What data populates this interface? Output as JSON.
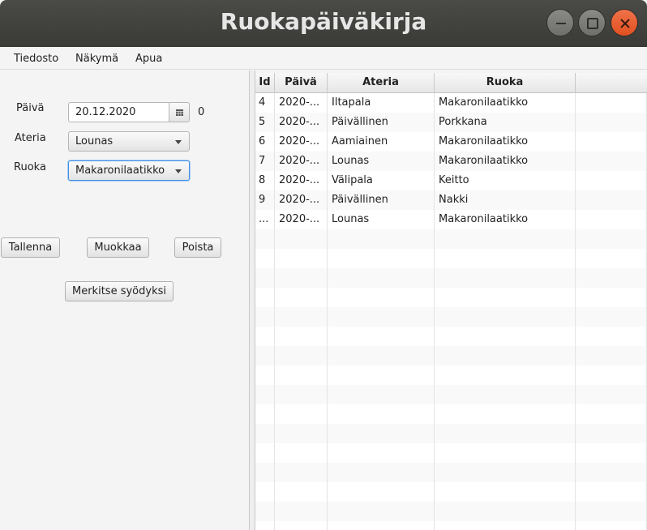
{
  "window": {
    "title": "Ruokapäiväkirja"
  },
  "menu": [
    "Tiedosto",
    "Näkymä",
    "Apua"
  ],
  "form": {
    "date_label": "Päivä",
    "date_value": "20.12.2020",
    "date_extra": "0",
    "meal_label": "Ateria",
    "meal_value": "Lounas",
    "food_label": "Ruoka",
    "food_value": "Makaronilaatikko"
  },
  "buttons": {
    "save": "Tallenna",
    "edit": "Muokkaa",
    "delete": "Poista",
    "mark_eaten": "Merkitse syödyksi"
  },
  "table": {
    "columns": [
      "Id",
      "Päivä",
      "Ateria",
      "Ruoka"
    ],
    "rows": [
      [
        "4",
        "2020-...",
        "Iltapala",
        "Makaronilaatikko"
      ],
      [
        "5",
        "2020-...",
        "Päivällinen",
        "Porkkana"
      ],
      [
        "6",
        "2020-...",
        "Aamiainen",
        "Makaronilaatikko"
      ],
      [
        "7",
        "2020-...",
        "Lounas",
        "Makaronilaatikko"
      ],
      [
        "8",
        "2020-...",
        "Välipala",
        "Keitto"
      ],
      [
        "9",
        "2020-...",
        "Päivällinen",
        "Nakki"
      ],
      [
        "...",
        "2020-...",
        "Lounas",
        "Makaronilaatikko"
      ]
    ]
  }
}
